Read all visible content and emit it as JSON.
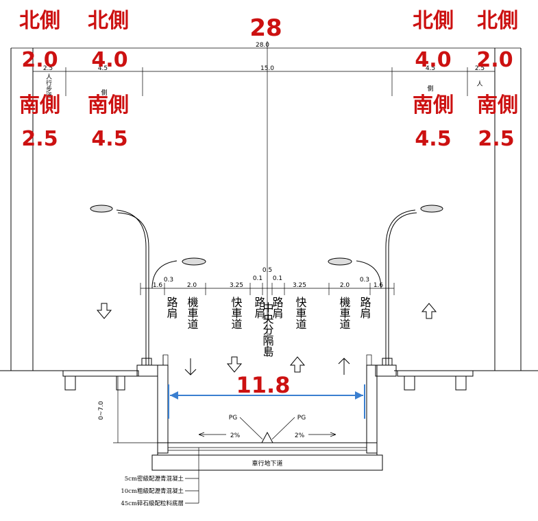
{
  "title_width": "28",
  "total_width_small": "28.0",
  "half_width_small": "15.0",
  "north_label": "北側",
  "south_label": "南側",
  "left": {
    "north_sidewalk": "2.0",
    "north_sidepath": "4.0",
    "south_sidewalk": "2.5",
    "south_sidepath": "4.5",
    "small_sidewalk": "2.5",
    "small_sidepath": "4.5",
    "sidewalk_vertical": "人行步道",
    "sidepath_vertical": "側"
  },
  "right": {
    "north_sidewalk": "2.0",
    "north_sidepath": "4.0",
    "south_sidewalk": "2.5",
    "south_sidepath": "4.5",
    "small_sidepath": "4.5",
    "small_sidewalk": "2.5",
    "sidewalk_vertical": "人",
    "sidepath_vertical": "側"
  },
  "lane_dims": {
    "shoulder_outer": "1.6",
    "shoulder": "0.3",
    "moto": "2.0",
    "fast": "3.25",
    "median_edge": "0.1",
    "median": "0.5"
  },
  "lanes": {
    "shoulder": "路肩",
    "moto": "機車道",
    "fast": "快車道",
    "median": "中央分隔島"
  },
  "underpass_width": "11.8",
  "depth_label": "0~7.0",
  "pg": "PG",
  "slope": "2%",
  "underpass_name": "車行地下道",
  "pavement_layers": [
    "5cm密級配瀝青混凝土",
    "10cm粗級配瀝青混凝土",
    "45cm碎石級配粒料底層"
  ],
  "colors": {
    "annotation": "#cc1111",
    "dimension": "#3a7fd0"
  }
}
